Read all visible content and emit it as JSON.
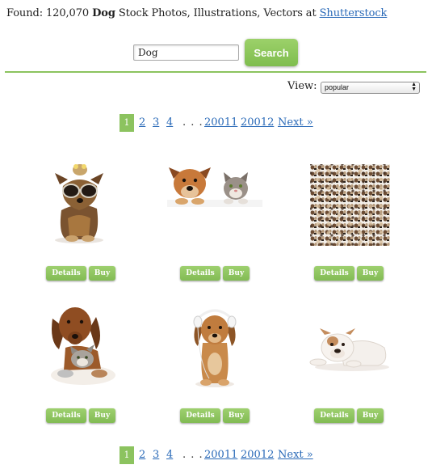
{
  "header": {
    "prefix": "Found: 120,070 ",
    "keyword": "Dog",
    "suffix": " Stock Photos, Illustrations, Vectors at ",
    "site_link": "Shutterstock"
  },
  "search": {
    "value": "Dog",
    "button_label": "Search"
  },
  "view": {
    "label": "View:",
    "selected": "popular"
  },
  "pagination": {
    "current": "1",
    "pages": [
      "2",
      "3",
      "4"
    ],
    "ellipsis": "…",
    "last_pages": [
      "20011",
      "20012"
    ],
    "next": "Next »"
  },
  "results": [
    {
      "subject": "yorkie-with-sunglasses",
      "details": "Details",
      "buy": "Buy"
    },
    {
      "subject": "dog-and-cat-peeking",
      "details": "Details",
      "buy": "Buy"
    },
    {
      "subject": "dogs-collage-mosaic",
      "details": "Details",
      "buy": "Buy"
    },
    {
      "subject": "dachshund-with-kitten",
      "details": "Details",
      "buy": "Buy"
    },
    {
      "subject": "puppy-with-headphones",
      "details": "Details",
      "buy": "Buy"
    },
    {
      "subject": "bulldog-puppy-lying",
      "details": "Details",
      "buy": "Buy"
    }
  ],
  "colors": {
    "accent_green": "#8cc35f",
    "link_blue": "#2a6ab8"
  }
}
